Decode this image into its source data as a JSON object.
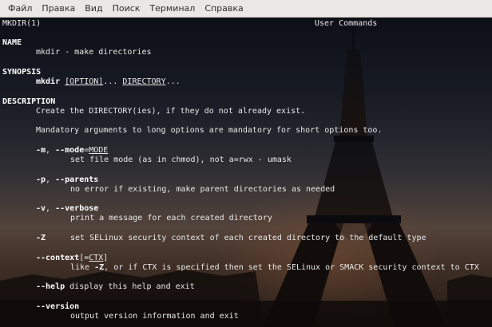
{
  "menubar": {
    "items": [
      "Файл",
      "Правка",
      "Вид",
      "Поиск",
      "Терминал",
      "Справка"
    ]
  },
  "man": {
    "header_left": "MKDIR(1)",
    "header_center": "User Commands",
    "name_heading": "NAME",
    "name_text": "mkdir - make directories",
    "synopsis_heading": "SYNOPSIS",
    "synopsis_cmd": "mkdir",
    "synopsis_option": "[OPTION]",
    "synopsis_dots": "...",
    "synopsis_directory": "DIRECTORY",
    "synopsis_tail": "...",
    "description_heading": "DESCRIPTION",
    "desc_1": "Create the DIRECTORY(ies), if they do not already exist.",
    "desc_2": "Mandatory arguments to long options are mandatory for short options too.",
    "options": [
      {
        "flag_short": "-m",
        "sep": ", ",
        "flag_long": "--mode",
        "eq": "=",
        "arg": "MODE",
        "desc": "set file mode (as in chmod), not a=rwx - umask"
      },
      {
        "flag_short": "-p",
        "sep": ", ",
        "flag_long": "--parents",
        "desc": "no error if existing, make parent directories as needed"
      },
      {
        "flag_short": "-v",
        "sep": ", ",
        "flag_long": "--verbose",
        "desc": "print a message for each created directory"
      },
      {
        "flag_short": "-Z",
        "desc": "set SELinux security context of each created directory to the default type"
      },
      {
        "flag_long": "--context",
        "bracket_open": "[=",
        "arg": "CTX",
        "bracket_close": "]",
        "desc_a": "like ",
        "desc_b": "-Z",
        "desc_c": ", or if CTX is specified then set the SELinux or SMACK security context to CTX"
      },
      {
        "flag_long": "--help",
        "desc": "display this help and exit"
      },
      {
        "flag_long": "--version",
        "desc": "output version information and exit"
      }
    ]
  }
}
